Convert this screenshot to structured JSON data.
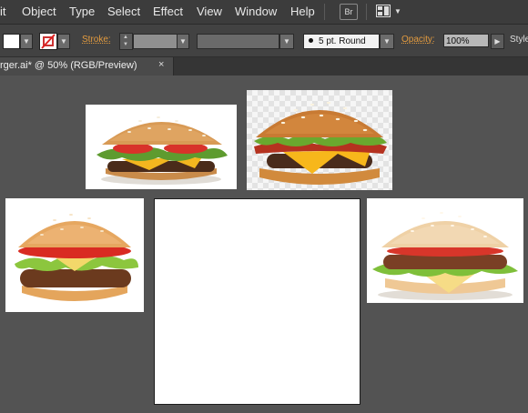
{
  "menubar": {
    "items": [
      "it",
      "Object",
      "Type",
      "Select",
      "Effect",
      "View",
      "Window",
      "Help"
    ],
    "bridge_label": "Br"
  },
  "controlbar": {
    "stroke_label": "Stroke:",
    "brush_label": "5 pt. Round",
    "opacity_label": "Opacity:",
    "opacity_value": "100%",
    "style_label": "Style"
  },
  "document": {
    "tab_title": "rger.ai* @ 50% (RGB/Preview)",
    "close_glyph": "×"
  },
  "icons": {
    "fill": "fill-swatch-icon",
    "stroke": "stroke-none-swatch-icon",
    "workspace": "workspace-switcher-icon"
  },
  "colors": {
    "brush_label": "#e39b3f",
    "canvas": "#535353",
    "menubar": "#3c3c3c"
  }
}
